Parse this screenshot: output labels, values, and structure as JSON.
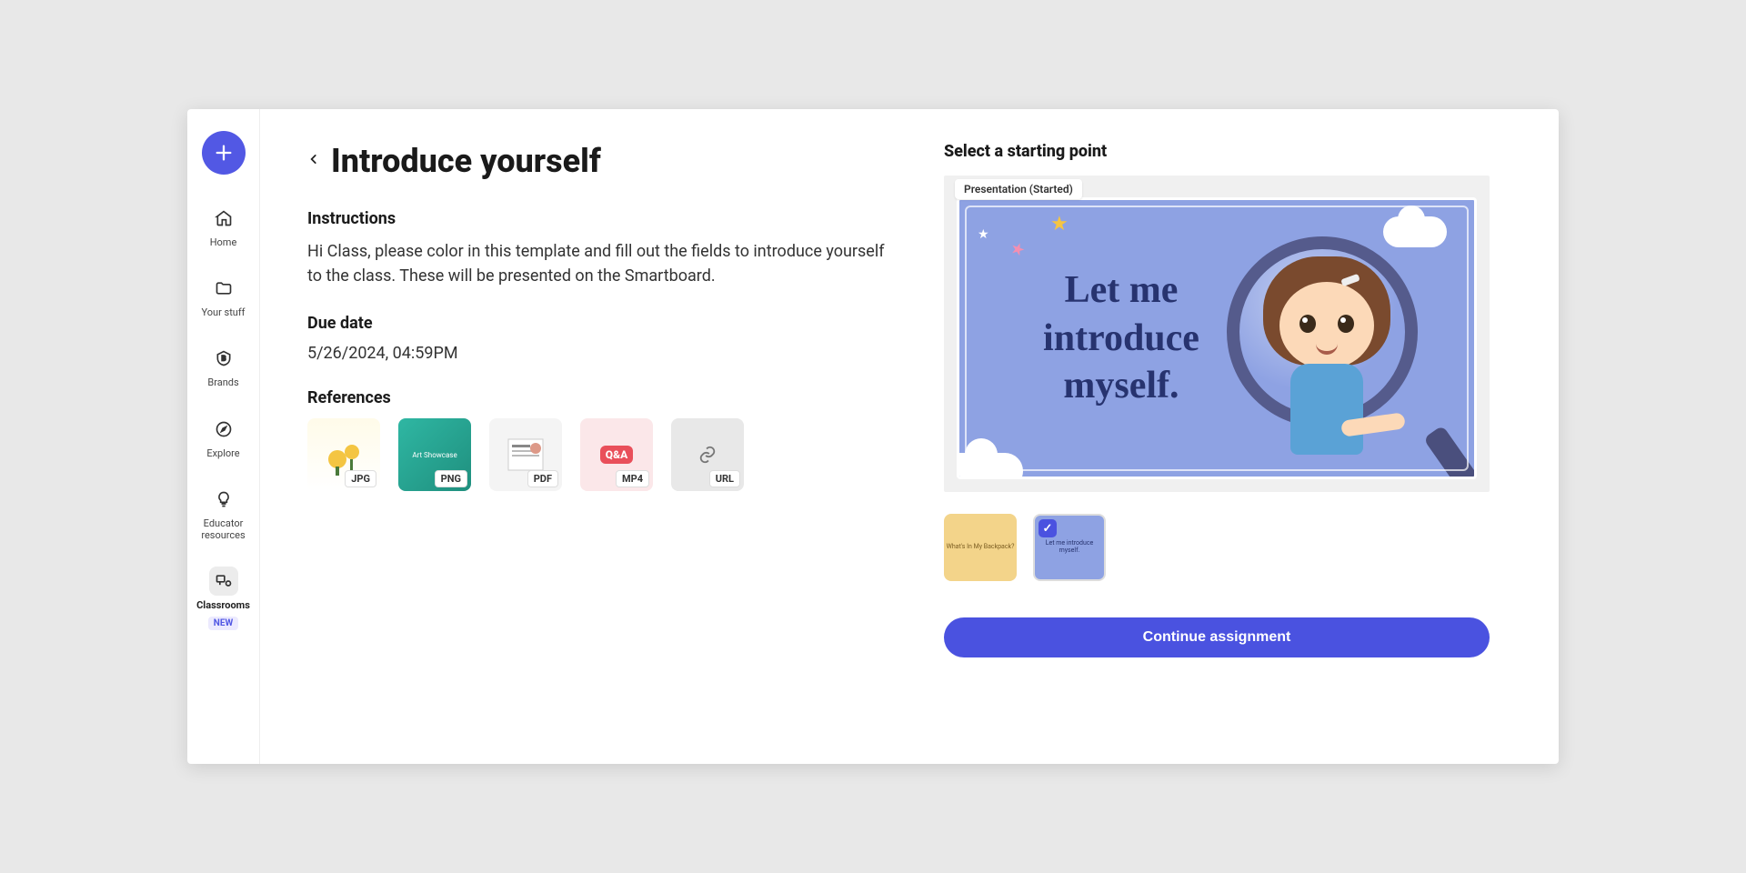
{
  "sidebar": {
    "items": [
      {
        "label": "Home"
      },
      {
        "label": "Your stuff"
      },
      {
        "label": "Brands"
      },
      {
        "label": "Explore"
      },
      {
        "label": "Educator resources"
      },
      {
        "label": "Classrooms"
      }
    ],
    "new_badge": "NEW"
  },
  "page": {
    "title": "Introduce yourself",
    "instructions_heading": "Instructions",
    "instructions_body": "Hi Class, please color in this template and fill out the fields to introduce yourself to the class. These will be presented on the Smartboard.",
    "due_heading": "Due date",
    "due_value": "5/26/2024, 04:59PM",
    "references_heading": "References",
    "references": [
      {
        "badge": "JPG"
      },
      {
        "badge": "PNG",
        "caption": "Art Showcase"
      },
      {
        "badge": "PDF"
      },
      {
        "badge": "MP4",
        "caption": "Q&A"
      },
      {
        "badge": "URL"
      }
    ]
  },
  "starting": {
    "heading": "Select a starting point",
    "preview_tag": "Presentation (Started)",
    "preview_text": "Let me introduce myself.",
    "thumbs": [
      {
        "label": "What's In My Backpack?",
        "selected": false
      },
      {
        "label": "Let me introduce myself.",
        "selected": true
      }
    ],
    "cta": "Continue assignment"
  }
}
